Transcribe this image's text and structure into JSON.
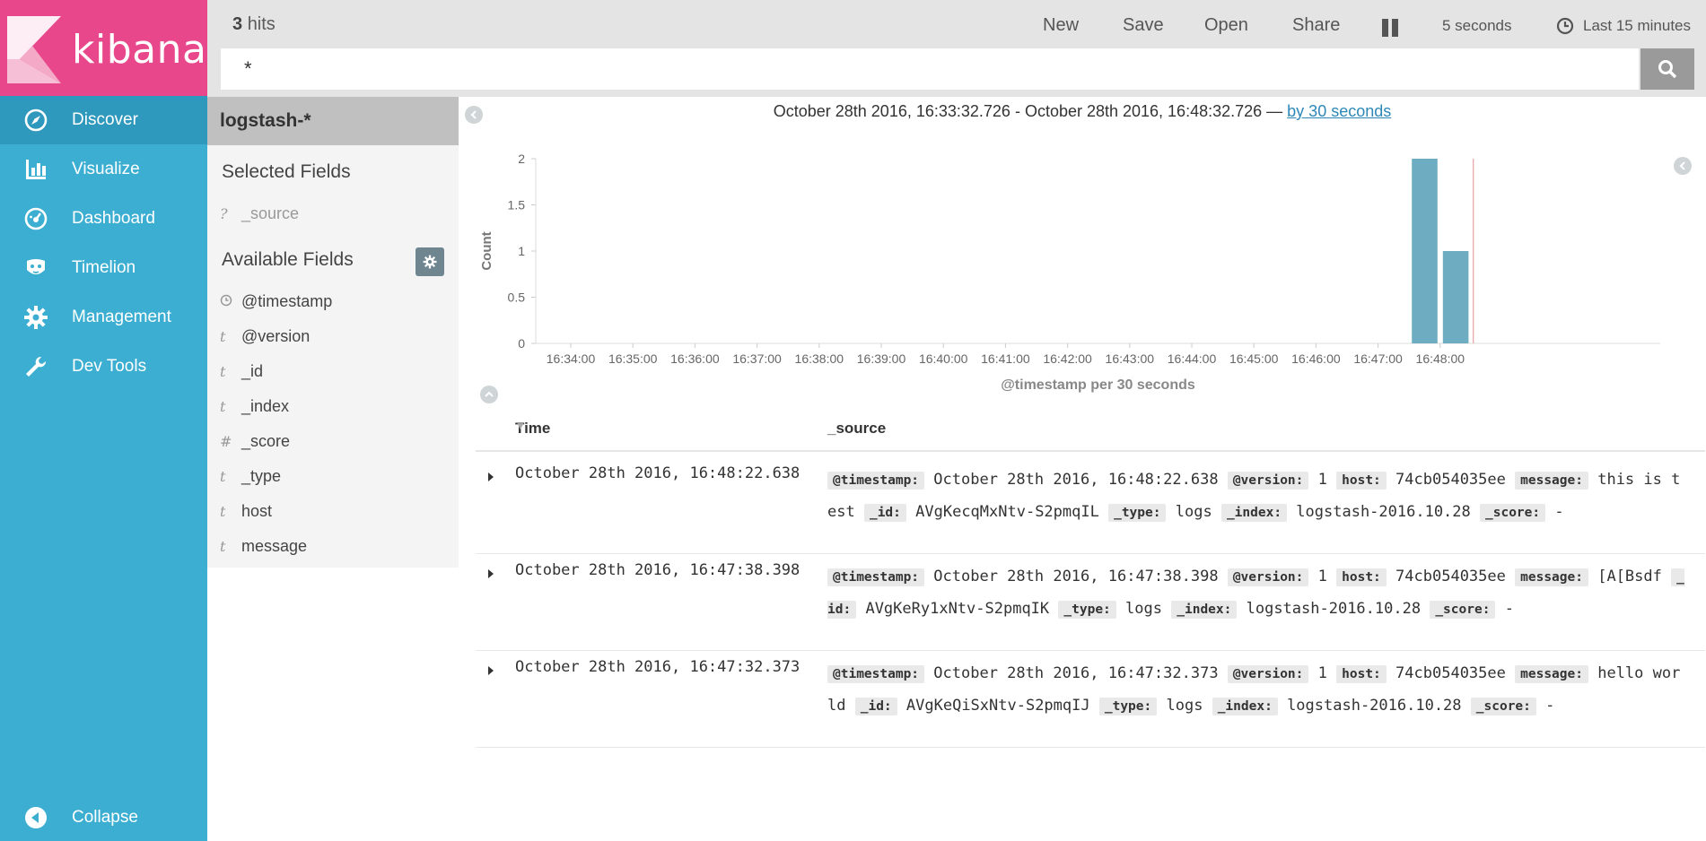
{
  "brand": {
    "name": "kibana",
    "color": "#e8488b"
  },
  "nav": {
    "items": [
      {
        "label": "Discover",
        "icon": "compass-icon",
        "active": true
      },
      {
        "label": "Visualize",
        "icon": "bar-chart-icon"
      },
      {
        "label": "Dashboard",
        "icon": "dashboard-icon"
      },
      {
        "label": "Timelion",
        "icon": "timelion-icon"
      },
      {
        "label": "Management",
        "icon": "gear-icon"
      },
      {
        "label": "Dev Tools",
        "icon": "wrench-icon"
      }
    ],
    "collapse_label": "Collapse"
  },
  "topbar": {
    "hits_count": "3",
    "hits_label": "hits",
    "buttons": {
      "new": "New",
      "save": "Save",
      "open": "Open",
      "share": "Share"
    },
    "refresh_interval": "5 seconds",
    "time_range": "Last 15 minutes",
    "query": "*"
  },
  "sidebar": {
    "index_pattern": "logstash-*",
    "selected_title": "Selected Fields",
    "selected_fields": [
      {
        "type": "?",
        "name": "_source"
      }
    ],
    "available_title": "Available Fields",
    "available_fields": [
      {
        "type": "clock",
        "name": "@timestamp"
      },
      {
        "type": "t",
        "name": "@version"
      },
      {
        "type": "t",
        "name": "_id"
      },
      {
        "type": "t",
        "name": "_index"
      },
      {
        "type": "#",
        "name": "_score"
      },
      {
        "type": "t",
        "name": "_type"
      },
      {
        "type": "t",
        "name": "host"
      },
      {
        "type": "t",
        "name": "message"
      }
    ]
  },
  "range": {
    "text": "October 28th 2016, 16:33:32.726 - October 28th 2016, 16:48:32.726 —",
    "interval_link": "by 30 seconds"
  },
  "chart_data": {
    "type": "bar",
    "ylabel": "Count",
    "xlabel": "@timestamp per 30 seconds",
    "ylim": [
      0,
      2
    ],
    "yticks": [
      "0",
      "0.5",
      "1",
      "1.5",
      "2"
    ],
    "xticks": [
      "16:34:00",
      "16:35:00",
      "16:36:00",
      "16:37:00",
      "16:38:00",
      "16:39:00",
      "16:40:00",
      "16:41:00",
      "16:42:00",
      "16:43:00",
      "16:44:00",
      "16:45:00",
      "16:46:00",
      "16:47:00",
      "16:48:00"
    ],
    "bars": [
      {
        "x": "16:47:30",
        "value": 2
      },
      {
        "x": "16:48:00",
        "value": 1
      }
    ],
    "color": "#6eadc1"
  },
  "table": {
    "col_time": "Time",
    "col_source": "_source",
    "rows": [
      {
        "time": "October 28th 2016, 16:48:22.638",
        "fields": [
          {
            "k": "@timestamp:",
            "v": "October 28th 2016, 16:48:22.638"
          },
          {
            "k": "@version:",
            "v": "1"
          },
          {
            "k": "host:",
            "v": "74cb054035ee"
          },
          {
            "k": "message:",
            "v": "this is test"
          },
          {
            "k": "_id:",
            "v": "AVgKecqMxNtv-S2pmqIL"
          },
          {
            "k": "_type:",
            "v": "logs"
          },
          {
            "k": "_index:",
            "v": "logstash-2016.10.28"
          },
          {
            "k": "_score:",
            "v": "-"
          }
        ]
      },
      {
        "time": "October 28th 2016, 16:47:38.398",
        "fields": [
          {
            "k": "@timestamp:",
            "v": "October 28th 2016, 16:47:38.398"
          },
          {
            "k": "@version:",
            "v": "1"
          },
          {
            "k": "host:",
            "v": "74cb054035ee"
          },
          {
            "k": "message:",
            "v": "[A[Bsdf"
          },
          {
            "k": "_id:",
            "v": "AVgKeRy1xNtv-S2pmqIK"
          },
          {
            "k": "_type:",
            "v": "logs"
          },
          {
            "k": "_index:",
            "v": "logstash-2016.10.28"
          },
          {
            "k": "_score:",
            "v": "-"
          }
        ]
      },
      {
        "time": "October 28th 2016, 16:47:32.373",
        "fields": [
          {
            "k": "@timestamp:",
            "v": "October 28th 2016, 16:47:32.373"
          },
          {
            "k": "@version:",
            "v": "1"
          },
          {
            "k": "host:",
            "v": "74cb054035ee"
          },
          {
            "k": "message:",
            "v": "hello world"
          },
          {
            "k": "_id:",
            "v": "AVgKeQiSxNtv-S2pmqIJ"
          },
          {
            "k": "_type:",
            "v": "logs"
          },
          {
            "k": "_index:",
            "v": "logstash-2016.10.28"
          },
          {
            "k": "_score:",
            "v": "-"
          }
        ]
      }
    ]
  }
}
